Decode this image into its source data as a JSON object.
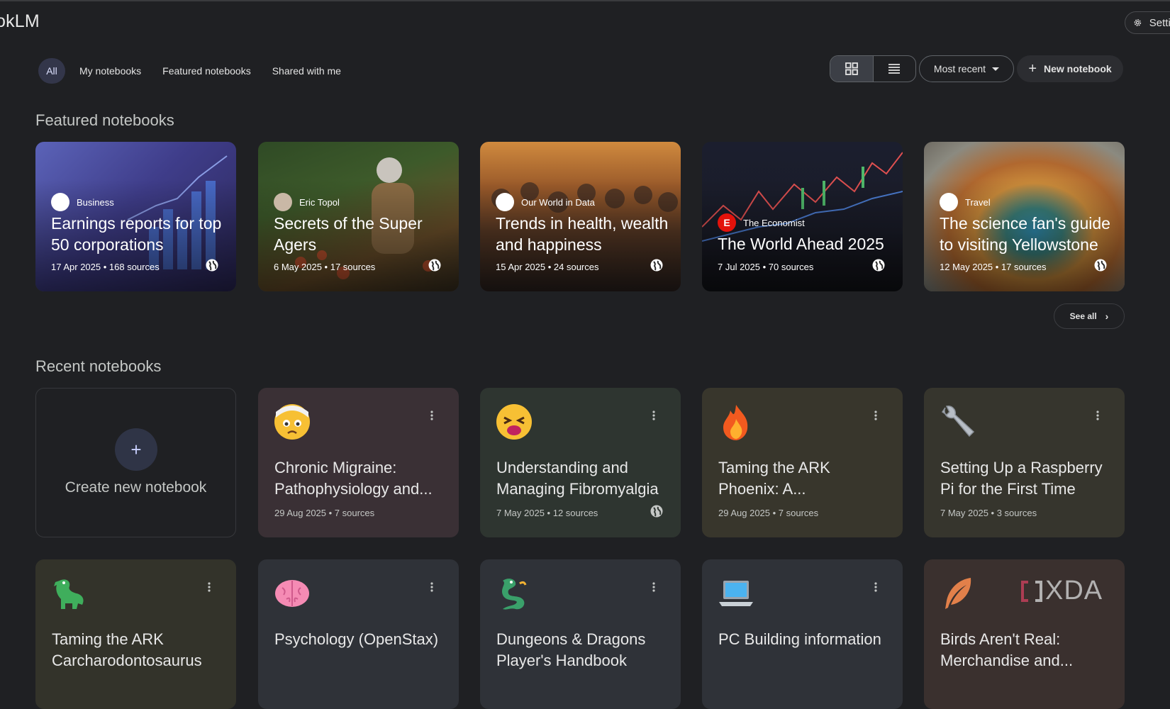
{
  "app": {
    "title": "okLM",
    "settings_label": "Settings"
  },
  "filters": [
    {
      "label": "All",
      "active": true
    },
    {
      "label": "My notebooks"
    },
    {
      "label": "Featured notebooks"
    },
    {
      "label": "Shared with me"
    }
  ],
  "toolbar": {
    "view_mode": "grid",
    "sort_label": "Most recent",
    "new_notebook_label": "New notebook"
  },
  "featured": {
    "section_title": "Featured notebooks",
    "see_all_label": "See all",
    "cards": [
      {
        "source": "Business",
        "title": "Earnings reports for top 50 corporations",
        "meta": "17 Apr 2025 • 168 sources"
      },
      {
        "source": "Eric Topol",
        "title": "Secrets of the Super Agers",
        "meta": "6 May 2025 • 17 sources"
      },
      {
        "source": "Our World in Data",
        "title": "Trends in health, wealth and happiness",
        "meta": "15 Apr 2025 • 24 sources"
      },
      {
        "source": "The Economist",
        "source_initial": "E",
        "title": "The World Ahead 2025",
        "meta": "7 Jul 2025 • 70 sources"
      },
      {
        "source": "Travel",
        "title": "The science fan's guide to visiting Yellowstone",
        "meta": "12 May 2025 • 17 sources"
      }
    ]
  },
  "recent": {
    "section_title": "Recent notebooks",
    "create_label": "Create new notebook",
    "cards": [
      {
        "icon": "face-with-bandage-icon",
        "title": "Chronic Migraine: Pathophysiology and...",
        "meta": "29 Aug 2025 • 7 sources",
        "public": false
      },
      {
        "icon": "tired-face-icon",
        "title": "Understanding and Managing Fibromyalgia",
        "meta": "7 May 2025 • 12 sources",
        "public": true
      },
      {
        "icon": "fire-icon",
        "title": "Taming the ARK Phoenix: A...",
        "meta": "29 Aug 2025 • 7 sources",
        "public": false
      },
      {
        "icon": "wrench-icon",
        "title": "Setting Up a Raspberry Pi for the First Time",
        "meta": "7 May 2025 • 3 sources",
        "public": false
      },
      {
        "icon": "dinosaur-icon",
        "title": "Taming the ARK Carcharodontosaurus"
      },
      {
        "icon": "brain-icon",
        "title": "Psychology (OpenStax)"
      },
      {
        "icon": "dragon-icon",
        "title": "Dungeons & Dragons Player's Handbook"
      },
      {
        "icon": "laptop-icon",
        "title": "PC Building information"
      },
      {
        "icon": "feather-icon",
        "title": "Birds Aren't Real: Merchandise and..."
      }
    ]
  },
  "watermark": {
    "text": "XDA"
  },
  "colors": {
    "background": "#1f2023",
    "accent_chip": "#33364a"
  }
}
